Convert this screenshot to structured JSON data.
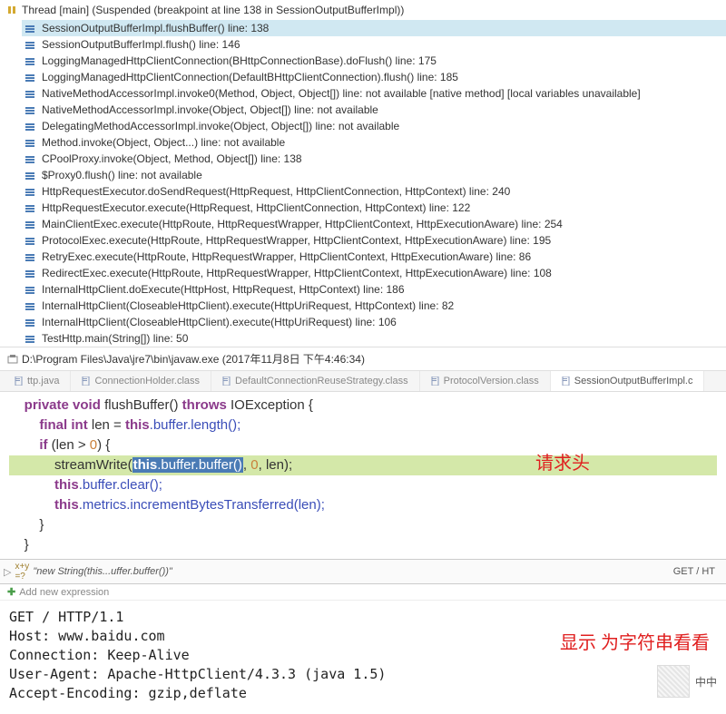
{
  "thread": {
    "title": "Thread [main] (Suspended (breakpoint at line 138 in SessionOutputBufferImpl))"
  },
  "frames": [
    {
      "text": "SessionOutputBufferImpl.flushBuffer() line: 138",
      "selected": true
    },
    {
      "text": "SessionOutputBufferImpl.flush() line: 146",
      "selected": false
    },
    {
      "text": "LoggingManagedHttpClientConnection(BHttpConnectionBase).doFlush() line: 175",
      "selected": false
    },
    {
      "text": "LoggingManagedHttpClientConnection(DefaultBHttpClientConnection).flush() line: 185",
      "selected": false
    },
    {
      "text": "NativeMethodAccessorImpl.invoke0(Method, Object, Object[]) line: not available [native method] [local variables unavailable]",
      "selected": false
    },
    {
      "text": "NativeMethodAccessorImpl.invoke(Object, Object[]) line: not available",
      "selected": false
    },
    {
      "text": "DelegatingMethodAccessorImpl.invoke(Object, Object[]) line: not available",
      "selected": false
    },
    {
      "text": "Method.invoke(Object, Object...) line: not available",
      "selected": false
    },
    {
      "text": "CPoolProxy.invoke(Object, Method, Object[]) line: 138",
      "selected": false
    },
    {
      "text": "$Proxy0.flush() line: not available",
      "selected": false
    },
    {
      "text": "HttpRequestExecutor.doSendRequest(HttpRequest, HttpClientConnection, HttpContext) line: 240",
      "selected": false
    },
    {
      "text": "HttpRequestExecutor.execute(HttpRequest, HttpClientConnection, HttpContext) line: 122",
      "selected": false
    },
    {
      "text": "MainClientExec.execute(HttpRoute, HttpRequestWrapper, HttpClientContext, HttpExecutionAware) line: 254",
      "selected": false
    },
    {
      "text": "ProtocolExec.execute(HttpRoute, HttpRequestWrapper, HttpClientContext, HttpExecutionAware) line: 195",
      "selected": false
    },
    {
      "text": "RetryExec.execute(HttpRoute, HttpRequestWrapper, HttpClientContext, HttpExecutionAware) line: 86",
      "selected": false
    },
    {
      "text": "RedirectExec.execute(HttpRoute, HttpRequestWrapper, HttpClientContext, HttpExecutionAware) line: 108",
      "selected": false
    },
    {
      "text": "InternalHttpClient.doExecute(HttpHost, HttpRequest, HttpContext) line: 186",
      "selected": false
    },
    {
      "text": "InternalHttpClient(CloseableHttpClient).execute(HttpUriRequest, HttpContext) line: 82",
      "selected": false
    },
    {
      "text": "InternalHttpClient(CloseableHttpClient).execute(HttpUriRequest) line: 106",
      "selected": false
    },
    {
      "text": "TestHttp.main(String[]) line: 50",
      "selected": false
    }
  ],
  "process": {
    "text": "D:\\Program Files\\Java\\jre7\\bin\\javaw.exe (2017年11月8日 下午4:46:34)"
  },
  "tabs": [
    {
      "label": "ttp.java",
      "active": false
    },
    {
      "label": "ConnectionHolder.class",
      "active": false
    },
    {
      "label": "DefaultConnectionReuseStrategy.class",
      "active": false
    },
    {
      "label": "ProtocolVersion.class",
      "active": false
    },
    {
      "label": "SessionOutputBufferImpl.c",
      "active": true
    }
  ],
  "code": {
    "l1_kw1": "private",
    "l1_kw2": "void",
    "l1_m": "flushBuffer()",
    "l1_kw3": "throws",
    "l1_e": "IOException {",
    "l2_kw1": "final",
    "l2_kw2": "int",
    "l2_v": "len = ",
    "l2_kw3": "this",
    "l2_r": ".buffer.length();",
    "l3_kw1": "if",
    "l3_p": " (len > ",
    "l3_n": "0",
    "l3_r": ") {",
    "l4_a": "            streamWrite(",
    "l4_kw": "this",
    "l4_b": ".buffer.buffer()",
    "l4_c": ", ",
    "l4_n1": "0",
    "l4_d": ", len);",
    "l5_indent": "            ",
    "l5_kw": "this",
    "l5_r": ".buffer.clear();",
    "l6_indent": "            ",
    "l6_kw": "this",
    "l6_r": ".metrics.incrementBytesTransferred(len);",
    "l7": "        }",
    "l8": "    }"
  },
  "annotation1": "请求头",
  "expr": {
    "name": "\"new String(this...uffer.buffer())\"",
    "val": "GET / HT"
  },
  "addExpr": "Add new expression",
  "http": "GET / HTTP/1.1\nHost: www.baidu.com\nConnection: Keep-Alive\nUser-Agent: Apache-HttpClient/4.3.3 (java 1.5)\nAccept-Encoding: gzip,deflate",
  "annotation2": "显示 为字符串看看",
  "qr": "中中"
}
